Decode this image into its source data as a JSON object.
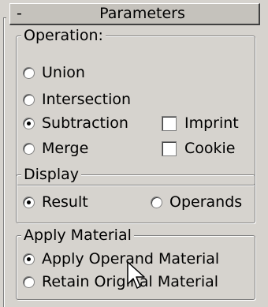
{
  "rollout": {
    "collapse_symbol": "-",
    "title": "Parameters"
  },
  "operation": {
    "legend": "Operation:",
    "options": [
      "Union",
      "Intersection",
      "Subtraction",
      "Merge"
    ],
    "selected": "Subtraction",
    "checkboxes": [
      {
        "label": "Imprint",
        "checked": false
      },
      {
        "label": "Cookie",
        "checked": false
      }
    ]
  },
  "display": {
    "legend": "Display",
    "options": [
      "Result",
      "Operands"
    ],
    "selected": "Result"
  },
  "material": {
    "legend": "Apply Material",
    "options": [
      "Apply Operand Material",
      "Retain Original Material"
    ],
    "selected": "Apply Operand Material"
  },
  "icons": {
    "cursor": "arrow-cursor-icon"
  },
  "colors": {
    "panel": "#d6d3ce",
    "title_bar": "#c5c2bc"
  }
}
